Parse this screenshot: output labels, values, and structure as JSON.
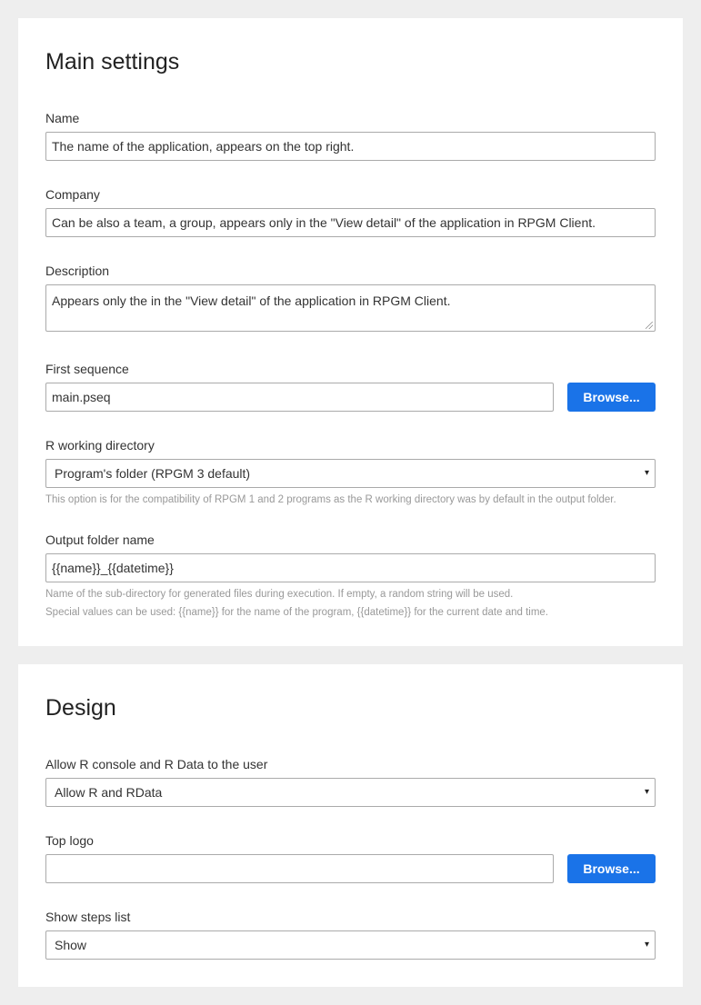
{
  "main_settings": {
    "title": "Main settings",
    "name": {
      "label": "Name",
      "value": "The name of the application, appears on the top right."
    },
    "company": {
      "label": "Company",
      "value": "Can be also a team, a group, appears only in the \"View detail\" of the application in RPGM Client."
    },
    "description": {
      "label": "Description",
      "value": "Appears only the in the \"View detail\" of the application in RPGM Client."
    },
    "first_sequence": {
      "label": "First sequence",
      "value": "main.pseq",
      "browse_label": "Browse..."
    },
    "r_working_directory": {
      "label": "R working directory",
      "selected": "Program's folder (RPGM 3 default)",
      "help": "This option is for the compatibility of RPGM 1 and 2 programs as the R working directory was by default in the output folder."
    },
    "output_folder_name": {
      "label": "Output folder name",
      "value": "{{name}}_{{datetime}}",
      "help_line1": "Name of the sub-directory for generated files during execution. If empty, a random string will be used.",
      "help_line2": "Special values can be used: {{name}} for the name of the program, {{datetime}} for the current date and time."
    }
  },
  "design": {
    "title": "Design",
    "allow_r_console": {
      "label": "Allow R console and R Data to the user",
      "selected": "Allow R and RData"
    },
    "top_logo": {
      "label": "Top logo",
      "value": "",
      "browse_label": "Browse..."
    },
    "show_steps_list": {
      "label": "Show steps list",
      "selected": "Show"
    }
  },
  "icons": {
    "select_caret": "▾"
  },
  "colors": {
    "page_background": "#eeeeee",
    "card_background": "#ffffff",
    "button_primary": "#1a73e8",
    "help_text": "#999999"
  }
}
